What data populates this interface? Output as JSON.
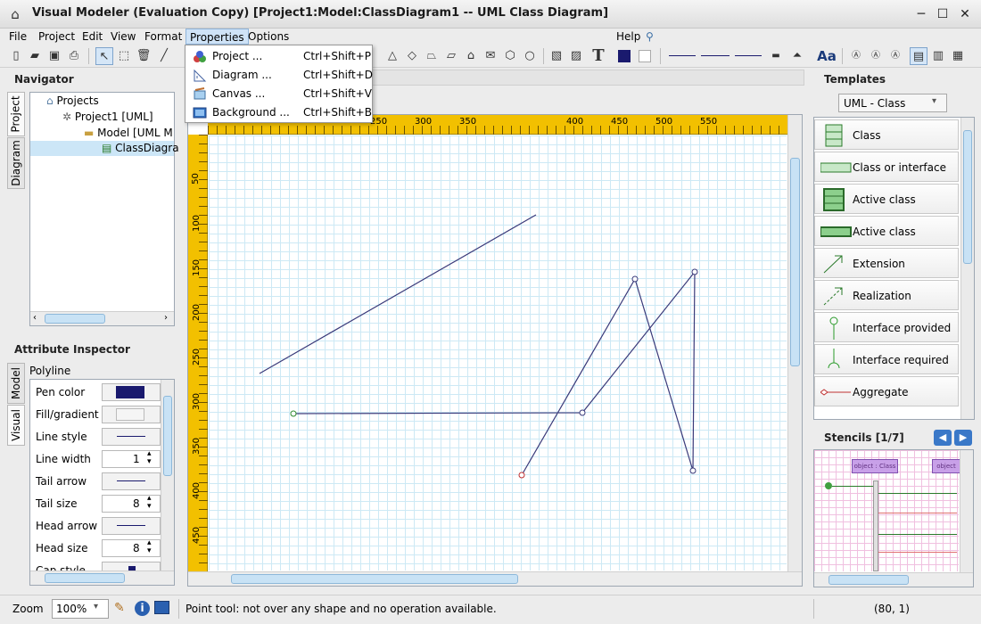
{
  "window": {
    "title": "Visual Modeler  (Evaluation Copy) [Project1:Model:ClassDiagram1 -- UML Class Diagram]"
  },
  "menu": [
    "File",
    "Project",
    "Edit",
    "View",
    "Format",
    "Properties",
    "Options"
  ],
  "menu_help": "Help",
  "properties_menu": [
    {
      "label": "Project ...",
      "shortcut": "Ctrl+Shift+P"
    },
    {
      "label": "Diagram ...",
      "shortcut": "Ctrl+Shift+D"
    },
    {
      "label": "Canvas ...",
      "shortcut": "Ctrl+Shift+V"
    },
    {
      "label": "Background ...",
      "shortcut": "Ctrl+Shift+B"
    }
  ],
  "toolbar": {
    "text_tool": "T",
    "font_tool": "Aa"
  },
  "navigator": {
    "title": "Navigator",
    "tabs": [
      "Project",
      "Diagram"
    ],
    "tree": [
      "Projects",
      "Project1 [UML]",
      "Model [UML M",
      "ClassDiagra"
    ]
  },
  "inspector": {
    "title": "Attribute Inspector",
    "tabs": [
      "Model",
      "Visual"
    ],
    "object": "Polyline",
    "rows": [
      {
        "label": "Pen color",
        "kind": "color",
        "value": "#1a1a6e"
      },
      {
        "label": "Fill/gradient",
        "kind": "fill",
        "value": ""
      },
      {
        "label": "Line style",
        "kind": "line",
        "value": ""
      },
      {
        "label": "Line width",
        "kind": "num",
        "value": "1"
      },
      {
        "label": "Tail arrow",
        "kind": "line",
        "value": ""
      },
      {
        "label": "Tail size",
        "kind": "num",
        "value": "8"
      },
      {
        "label": "Head arrow",
        "kind": "line",
        "value": ""
      },
      {
        "label": "Head size",
        "kind": "num",
        "value": "8"
      },
      {
        "label": "Cap style",
        "kind": "cap",
        "value": ""
      }
    ]
  },
  "ruler": {
    "top": [
      "250",
      "300",
      "350",
      "400",
      "450",
      "500",
      "550"
    ],
    "left": [
      "50",
      "100",
      "150",
      "200",
      "250",
      "300",
      "350",
      "400",
      "450"
    ]
  },
  "templates": {
    "title": "Templates",
    "selector": "UML - Class",
    "items": [
      "Class",
      "Class or interface",
      "Active class",
      "Active class",
      "Extension",
      "Realization",
      "Interface provided",
      "Interface required",
      "Aggregate"
    ]
  },
  "stencils": {
    "title": "Stencils [1/7]",
    "preview_labels": [
      "object : Class",
      "object"
    ]
  },
  "status": {
    "zoom_label": "Zoom",
    "zoom_value": "100%",
    "message": "Point tool: not over any shape and no operation available.",
    "coords": "(80, 1)"
  },
  "colors": {
    "line": "#3a3a7a",
    "accent": "#1a1a6e",
    "grid": "#cde9f5"
  }
}
